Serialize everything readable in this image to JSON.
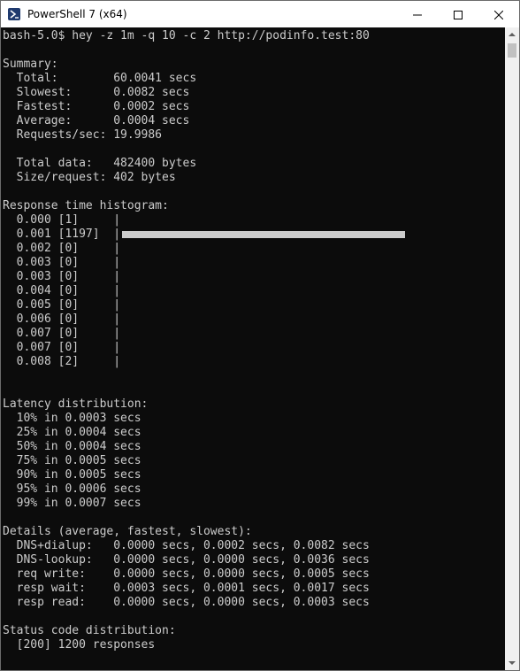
{
  "window": {
    "title": "PowerShell 7 (x64)"
  },
  "icons": {
    "app": "powershell-icon",
    "minimize": "minimize-icon",
    "maximize": "maximize-icon",
    "close": "close-icon",
    "scroll_up": "arrow-up-icon",
    "scroll_down": "arrow-down-icon"
  },
  "colors": {
    "terminal_bg": "#0c0c0c",
    "terminal_fg": "#cccccc",
    "titlebar_bg": "#ffffff"
  },
  "terminal": {
    "prompt": "bash-5.0$ hey -z 1m -q 10 -c 2 http://podinfo.test:80",
    "summary_heading": "Summary:",
    "summary": [
      "  Total:        60.0041 secs",
      "  Slowest:      0.0082 secs",
      "  Fastest:      0.0002 secs",
      "  Average:      0.0004 secs",
      "  Requests/sec: 19.9986"
    ],
    "data_lines": [
      "  Total data:   482400 bytes",
      "  Size/request: 402 bytes"
    ],
    "histogram_heading": "Response time histogram:",
    "histogram": [
      "  0.000 [1]     |",
      "  0.001 [1197]  |",
      "  0.002 [0]     |",
      "  0.003 [0]     |",
      "  0.003 [0]     |",
      "  0.004 [0]     |",
      "  0.005 [0]     |",
      "  0.006 [0]     |",
      "  0.007 [0]     |",
      "  0.007 [0]     |",
      "  0.008 [2]     |"
    ],
    "histogram_bar_fraction": 1.0,
    "latency_heading": "Latency distribution:",
    "latency": [
      "  10% in 0.0003 secs",
      "  25% in 0.0004 secs",
      "  50% in 0.0004 secs",
      "  75% in 0.0005 secs",
      "  90% in 0.0005 secs",
      "  95% in 0.0006 secs",
      "  99% in 0.0007 secs"
    ],
    "details_heading": "Details (average, fastest, slowest):",
    "details": [
      "  DNS+dialup:   0.0000 secs, 0.0002 secs, 0.0082 secs",
      "  DNS-lookup:   0.0000 secs, 0.0000 secs, 0.0036 secs",
      "  req write:    0.0000 secs, 0.0000 secs, 0.0005 secs",
      "  resp wait:    0.0003 secs, 0.0001 secs, 0.0017 secs",
      "  resp read:    0.0000 secs, 0.0000 secs, 0.0003 secs"
    ],
    "status_heading": "Status code distribution:",
    "status": [
      "  [200] 1200 responses"
    ]
  }
}
